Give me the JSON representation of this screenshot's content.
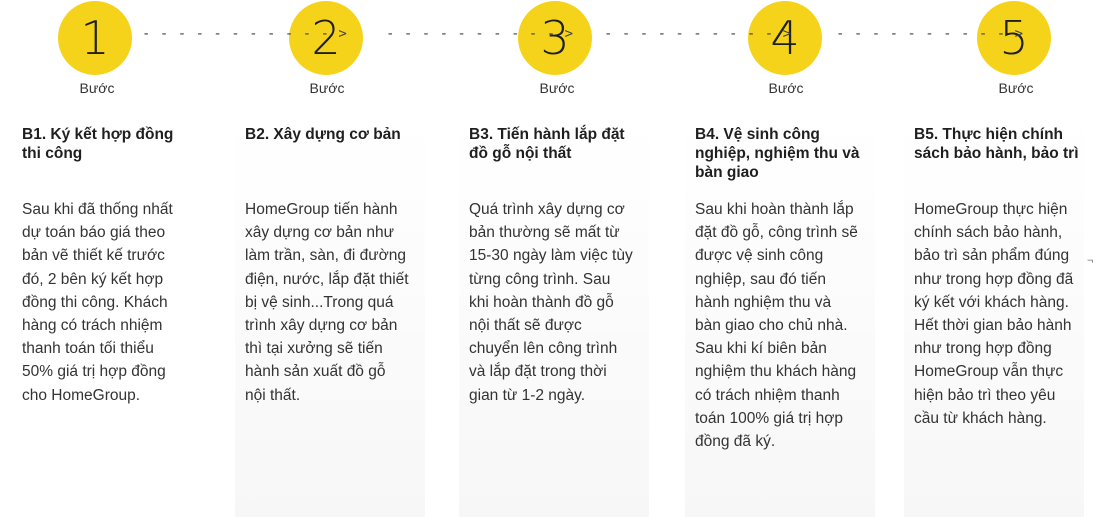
{
  "accent_color": "#f5d31b",
  "steps": [
    {
      "number": "1",
      "step_word": "Bước",
      "title": "B1. Ký kết hợp đồng\nthi công",
      "description": "Sau khi đã thống nhất\ndự toán báo giá theo\nbản vẽ thiết kế trước\nđó, 2 bên ký kết hợp\nđồng thi công. Khách\nhàng có trách nhiệm\nthanh toán tối thiểu\n50% giá trị hợp đồng\ncho HomeGroup."
    },
    {
      "number": "2",
      "step_word": "Bước",
      "title": "B2. Xây dựng cơ bản",
      "description": "HomeGroup tiến hành\nxây dựng cơ bản như\nlàm trần, sàn, đi đường\nđiện, nước, lắp đặt thiết\nbị vệ sinh...Trong quá\ntrình xây dựng cơ bản\nthì tại xưởng sẽ tiến\nhành sản xuất đồ gỗ\nnội thất."
    },
    {
      "number": "3",
      "step_word": "Bước",
      "title": "B3. Tiến hành lắp đặt\nđồ gỗ nội thất",
      "description": "Quá trình xây dựng cơ\nbản thường sẽ mất từ\n15-30 ngày làm việc tùy\ntừng công trình. Sau\nkhi hoàn thành đồ gỗ\nnội thất sẽ được\nchuyển lên công trình\nvà lắp đặt trong thời\ngian từ 1-2 ngày."
    },
    {
      "number": "4",
      "step_word": "Bước",
      "title": "B4. Vệ sinh công\nnghiệp, nghiệm thu và\nbàn giao",
      "description": "Sau khi hoàn thành lắp\nđặt đồ gỗ, công trình sẽ\nđược vệ sinh công\nnghiệp, sau đó tiến\nhành nghiệm thu và\nbàn giao cho chủ nhà.\nSau khi kí biên bản\nnghiệm thu khách hàng\ncó trách nhiệm thanh\ntoán 100% giá trị hợp\nđồng đã ký."
    },
    {
      "number": "5",
      "step_word": "Bước",
      "title": "B5. Thực hiện chính\nsách bảo hành, bảo trì",
      "description": "HomeGroup thực hiện\nchính sách bảo hành,\nbảo trì sản phẩm đúng\nnhư trong hợp đồng đã\nký kết với khách hàng.\nHết thời gian bảo hành\nnhư trong hợp đồng\nHomeGroup vẫn thực\nhiện bảo trì theo yêu\ncầu từ khách hàng."
    }
  ],
  "connectors": [
    "- - - - - - - - - - - >",
    "- - - - - - - - - - >",
    "- - - - - - - - - - >",
    "- - - - - - - - - - >"
  ],
  "corner_mark": "¬"
}
